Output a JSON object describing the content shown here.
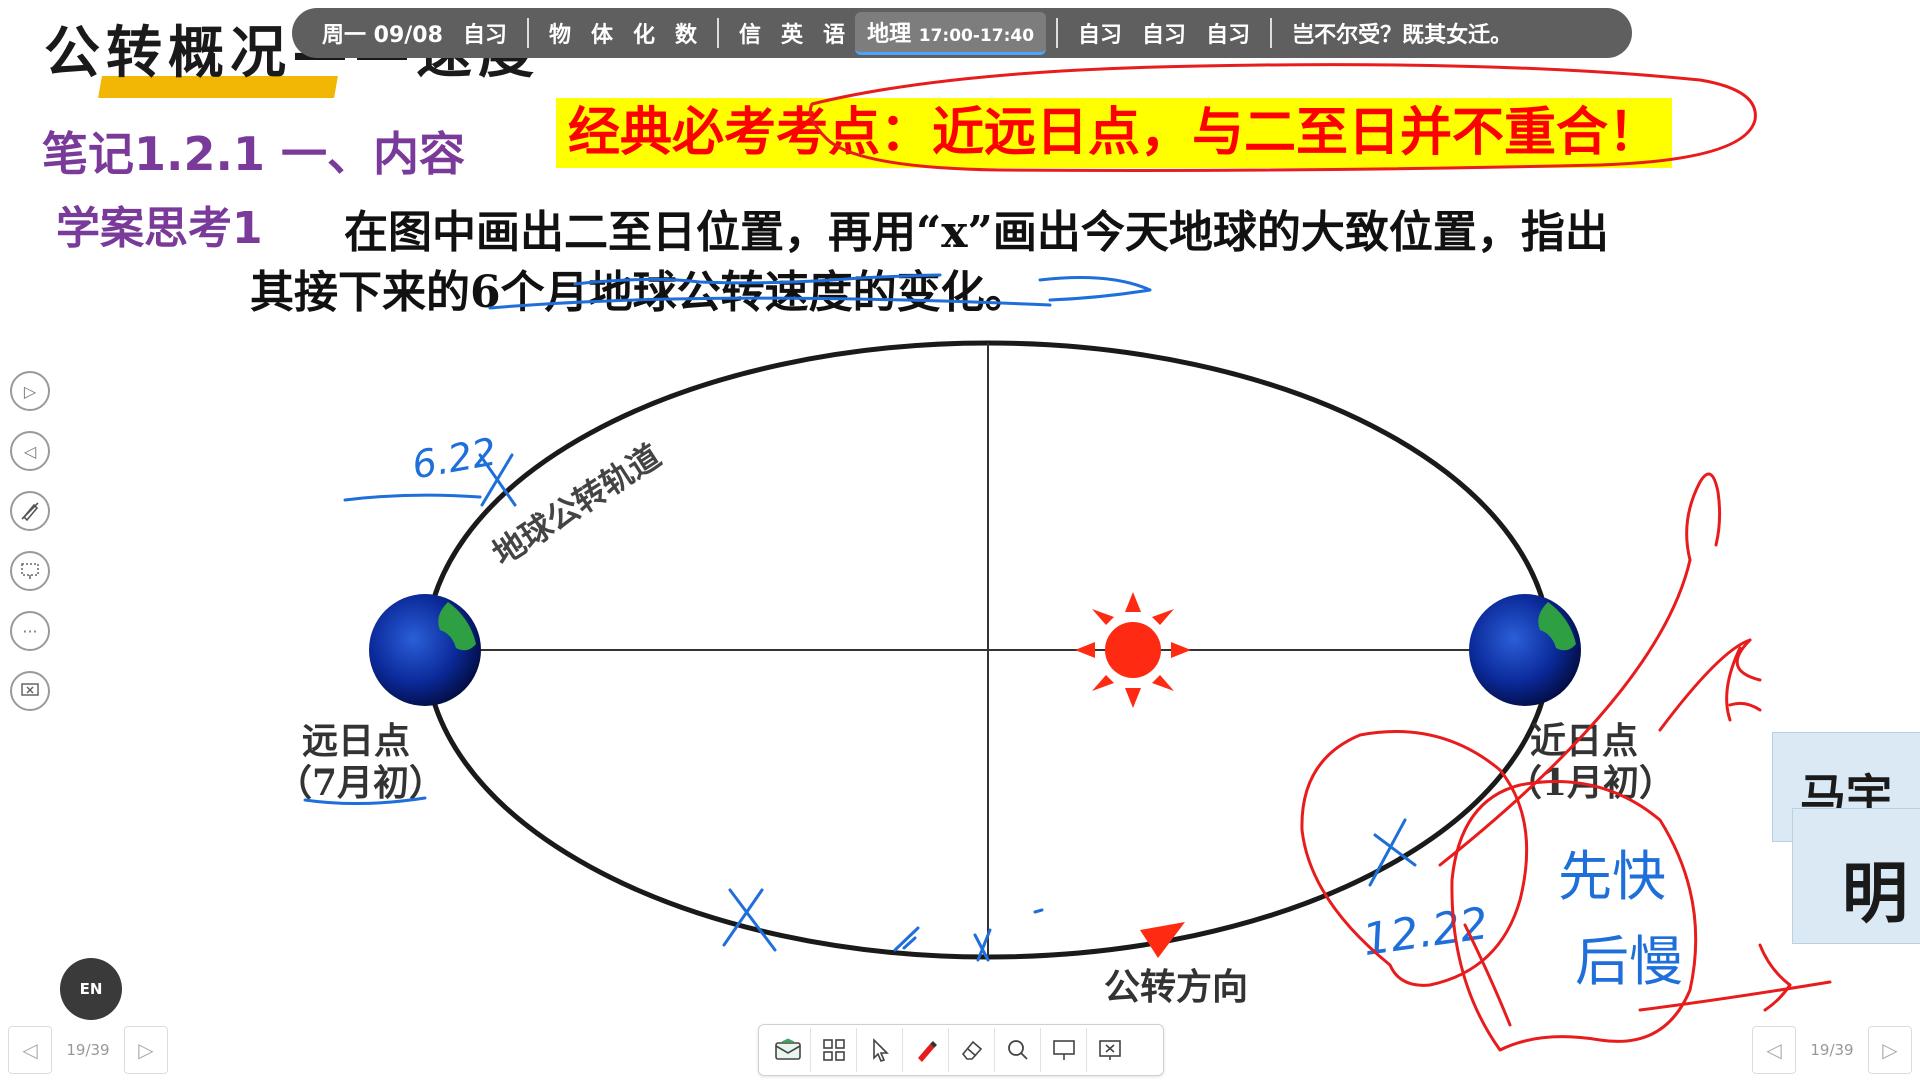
{
  "slide": {
    "title": "公转概况——速度",
    "note_heading": "笔记1.2.1 一、内容",
    "highlight_banner": "经典必考考点：近远日点，与二至日并不重合！",
    "think_label": "学案思考1",
    "question_line1": "在图中画出二至日位置，再用“x”画出今天地球的大致位置，指出",
    "question_line2": "其接下来的6个月地球公转速度的变化。"
  },
  "schedule_bar": {
    "date": "周一 09/08",
    "items": [
      "自习",
      "物",
      "体",
      "化",
      "数",
      "信",
      "英",
      "语"
    ],
    "active": {
      "subject": "地理",
      "time": "17:00-17:40"
    },
    "after": [
      "自习",
      "自习",
      "自习"
    ],
    "quote": "岂不尔受？既其女迁。"
  },
  "diagram": {
    "orbit_label": "地球公转轨道",
    "aphelion_label": "远日点",
    "aphelion_month": "（7月初）",
    "perihelion_label": "近日点",
    "perihelion_month": "（1月初）",
    "direction_label": "公转方向",
    "colors": {
      "sun": "#ff2a12",
      "arrow": "#ff2a12",
      "orbit": "#1a1a1a"
    }
  },
  "annotations": {
    "summer_solstice": "6.22",
    "winter_solstice": "12.22",
    "speed_change": [
      "先快",
      "后慢"
    ],
    "colors": {
      "blue": "#1e6fd9",
      "red": "#e81c1c"
    }
  },
  "left_tools": [
    "play-forward-icon",
    "play-back-icon",
    "pen-settings-icon",
    "screen-capture-icon",
    "more-icon",
    "close-screen-icon"
  ],
  "language_badge": "EN",
  "bottom_toolbar": [
    "envelope-icon",
    "grid-icon",
    "cursor-icon",
    "pen-icon",
    "eraser-icon",
    "magnifier-icon",
    "presentation-icon",
    "exit-presentation-icon"
  ],
  "pager": {
    "page": "19/39"
  },
  "name_card": {
    "name_partial": "马宇",
    "char": "明"
  }
}
